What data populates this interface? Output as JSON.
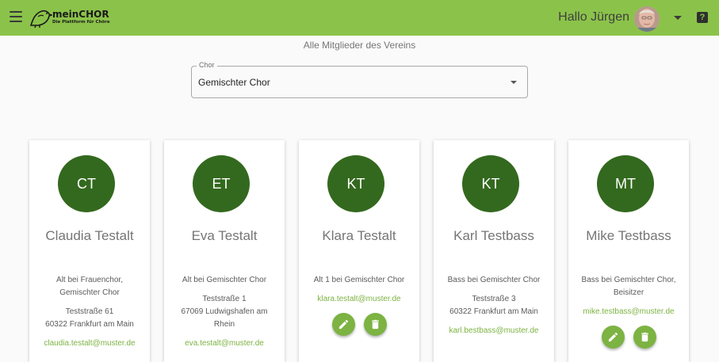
{
  "header": {
    "brand_name": "meinCHOR",
    "brand_tagline": "Die Plattform für Chöre",
    "greeting": "Hallo Jürgen",
    "menu_icon": "hamburger-menu-icon",
    "account_icon": "dropdown-caret-icon",
    "help_icon": "help-question-icon"
  },
  "page": {
    "subtitle": "Alle Mitglieder des Vereins"
  },
  "filter": {
    "label": "Chor",
    "value": "Gemischter Chor"
  },
  "members": [
    {
      "initials": "CT",
      "name": "Claudia Testalt",
      "role": "Alt bei Frauenchor, Gemischter Chor",
      "street": "Teststraße 61",
      "city": "60322 Frankfurt am Main",
      "email": "claudia.testalt@muster.de"
    },
    {
      "initials": "ET",
      "name": "Eva Testalt",
      "role": "Alt bei Gemischter Chor",
      "street": "Teststraße 1",
      "city": "67069 Ludwigshafen am Rhein",
      "email": "eva.testalt@muster.de"
    },
    {
      "initials": "KT",
      "name": "Klara Testalt",
      "role": "Alt 1 bei Gemischter Chor",
      "email": "klara.testalt@muster.de"
    },
    {
      "initials": "KT",
      "name": "Karl Testbass",
      "role": "Bass bei Gemischter Chor",
      "street": "Teststraße 3",
      "city": "60322 Frankfurt am Main",
      "email": "karl.bestbass@muster.de"
    },
    {
      "initials": "MT",
      "name": "Mike Testbass",
      "role": "Bass bei Gemischter Chor, Beisitzer",
      "email": "mike.testbass@muster.de"
    }
  ],
  "colors": {
    "header_bg": "#8bc34a",
    "avatar_bg": "#33691e",
    "accent": "#7cb342"
  },
  "icons": {
    "edit": "pencil-icon",
    "delete": "trash-icon"
  }
}
